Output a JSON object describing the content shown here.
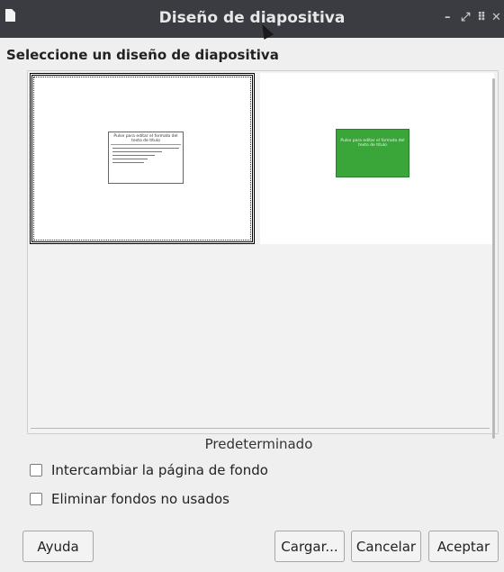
{
  "window": {
    "title": "Diseño de diapositiva",
    "controls": [
      "–",
      "⤢",
      "⠿",
      "✕"
    ]
  },
  "heading": "Seleccione un diseño de diapositiva",
  "thumbnails": [
    {
      "title_text": "Pulse para editar el formato del texto de título"
    },
    {
      "title_text": "Pulse para editar el formato del texto de título"
    }
  ],
  "default_label": "Predeterminado",
  "options": {
    "exchange_background": "Intercambiar la página de fondo",
    "delete_unused": "Eliminar fondos no usados"
  },
  "buttons": {
    "help": "Ayuda",
    "load": "Cargar...",
    "cancel": "Cancelar",
    "accept": "Aceptar"
  }
}
